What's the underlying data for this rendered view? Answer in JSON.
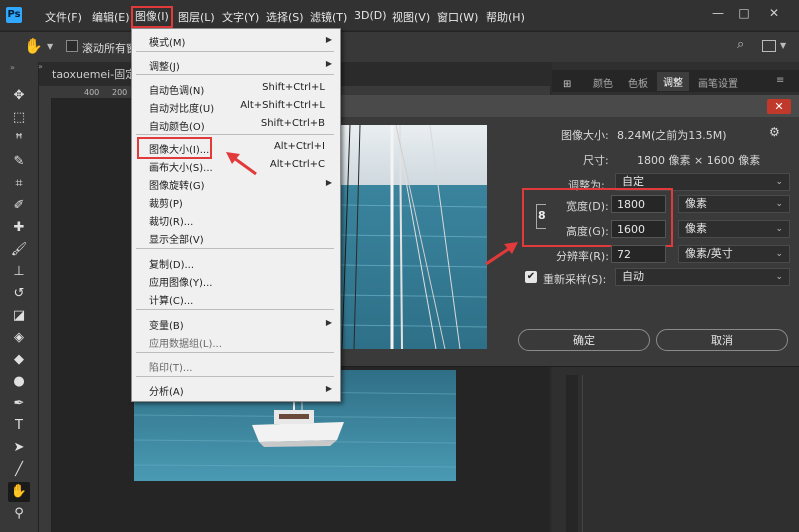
{
  "app": {
    "logo": "Ps"
  },
  "menubar": {
    "items": [
      "文件(F)",
      "编辑(E)",
      "图像(I)",
      "图层(L)",
      "文字(Y)",
      "选择(S)",
      "滤镜(T)",
      "3D(D)",
      "视图(V)",
      "窗口(W)",
      "帮助(H)"
    ],
    "window_buttons": [
      "—",
      "□",
      "✕"
    ]
  },
  "optbar": {
    "scroll_all_label": "滚动所有窗"
  },
  "document": {
    "tab_label": "taoxuemei-固定尺",
    "ruler_h": [
      "400",
      "200"
    ],
    "ruler_v": [
      "0",
      "1",
      "2",
      "3",
      "4",
      "5",
      "6",
      "7",
      "8",
      "9"
    ]
  },
  "image_menu": {
    "items": [
      {
        "label": "模式(M)",
        "shortcut": "",
        "submenu": true,
        "disabled": false
      },
      {
        "label": "调整(J)",
        "shortcut": "",
        "submenu": true,
        "disabled": false
      },
      {
        "label": "自动色调(N)",
        "shortcut": "Shift+Ctrl+L",
        "disabled": false
      },
      {
        "label": "自动对比度(U)",
        "shortcut": "Alt+Shift+Ctrl+L",
        "disabled": false
      },
      {
        "label": "自动颜色(O)",
        "shortcut": "Shift+Ctrl+B",
        "disabled": false
      },
      {
        "label": "图像大小(I)...",
        "shortcut": "Alt+Ctrl+I",
        "disabled": false
      },
      {
        "label": "画布大小(S)...",
        "shortcut": "Alt+Ctrl+C",
        "disabled": false
      },
      {
        "label": "图像旋转(G)",
        "shortcut": "",
        "submenu": true,
        "disabled": false
      },
      {
        "label": "裁剪(P)",
        "shortcut": "",
        "disabled": false
      },
      {
        "label": "裁切(R)...",
        "shortcut": "",
        "disabled": false
      },
      {
        "label": "显示全部(V)",
        "shortcut": "",
        "disabled": false
      },
      {
        "label": "复制(D)...",
        "shortcut": "",
        "disabled": false
      },
      {
        "label": "应用图像(Y)...",
        "shortcut": "",
        "disabled": false
      },
      {
        "label": "计算(C)...",
        "shortcut": "",
        "disabled": false
      },
      {
        "label": "变量(B)",
        "shortcut": "",
        "submenu": true,
        "disabled": false
      },
      {
        "label": "应用数据组(L)...",
        "shortcut": "",
        "disabled": true
      },
      {
        "label": "陷印(T)...",
        "shortcut": "",
        "disabled": true
      },
      {
        "label": "分析(A)",
        "shortcut": "",
        "submenu": true,
        "disabled": false
      }
    ]
  },
  "panels": {
    "tabs": [
      "颜色",
      "色板",
      "调整",
      "画笔设置"
    ]
  },
  "dialog": {
    "image_size_label": "图像大小:",
    "image_size_value": "8.24M(之前为13.5M)",
    "dimensions_label": "尺寸:",
    "dimensions_value": "1800 像素 × 1600 像素",
    "fit_to_label": "调整为:",
    "fit_to_value": "自定",
    "width_label": "宽度(D):",
    "width_value": "1800",
    "width_unit": "像素",
    "height_label": "高度(G):",
    "height_value": "1600",
    "height_unit": "像素",
    "resolution_label": "分辨率(R):",
    "resolution_value": "72",
    "resolution_unit": "像素/英寸",
    "resample_label": "重新采样(S):",
    "resample_value": "自动",
    "resample_checked": "✔",
    "ok_label": "确定",
    "cancel_label": "取消",
    "close_label": "✕"
  },
  "colors": {
    "highlight": "#e23a3a",
    "accent": "#31a8ff"
  }
}
